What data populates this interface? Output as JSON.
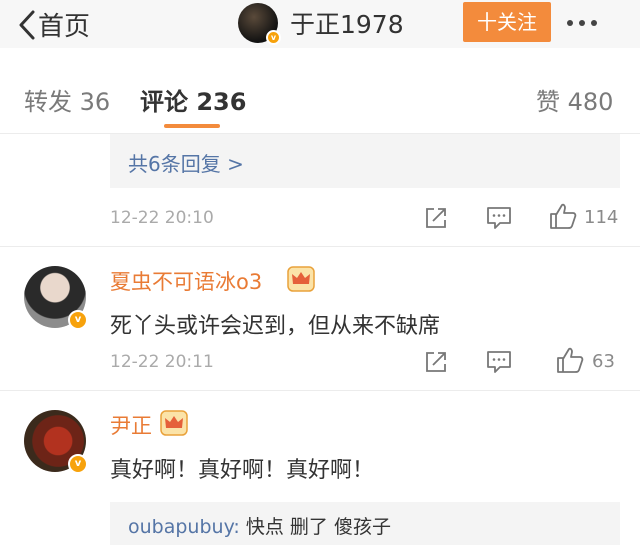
{
  "header": {
    "back_label": "首页",
    "user_name": "于正1978",
    "follow_label": "十关注"
  },
  "tabs": {
    "repost": "转发 36",
    "comments": "评论 236",
    "likes": "赞 480"
  },
  "thread_top": {
    "more_replies": "共6条回复 >",
    "time": "12-22 20:10",
    "likes": "114"
  },
  "comments": [
    {
      "user": "夏虫不可语冰o3",
      "text": "死丫头或许会迟到，但从来不缺席",
      "time": "12-22 20:11",
      "likes": "63"
    },
    {
      "user": "尹正",
      "text": "真好啊！真好啊！真好啊！",
      "reply_user": "oubapubuy:",
      "reply_text": "快点 删了 傻孩子"
    }
  ],
  "colors": {
    "accent": "#f38b3c",
    "username": "#e97b35",
    "link": "#5575a6",
    "verified_badge": "#f7a20c"
  },
  "icons": [
    "chevron-left-icon",
    "more-dots-icon",
    "verified-icon",
    "share-icon",
    "comment-icon",
    "thumbs-up-icon",
    "crown-icon"
  ]
}
